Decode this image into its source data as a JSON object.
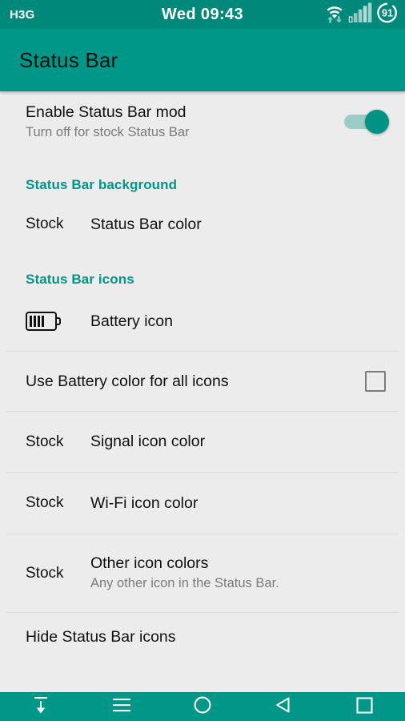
{
  "system_status_bar": {
    "carrier": "H3G",
    "clock": "Wed 09:43",
    "battery_percent": "91",
    "icons": [
      "wifi-with-data-arrows-icon",
      "cellular-signal-icon",
      "battery-circle-icon"
    ],
    "background_color": "#00897b",
    "foreground_color": "#ffffff"
  },
  "app_bar": {
    "title": "Status Bar",
    "background_color": "#009688",
    "title_color": "#111111"
  },
  "preferences": {
    "master_switch": {
      "title": "Enable Status Bar mod",
      "summary": "Turn off for stock Status Bar",
      "checked": true,
      "on_color": "#009285",
      "track_color": "#9cccc6"
    },
    "sections": [
      {
        "header": "Status Bar background",
        "header_color": "#009688",
        "items": [
          {
            "value": "Stock",
            "title": "Status Bar color",
            "summary": "",
            "widget": "none"
          }
        ]
      },
      {
        "header": "Status Bar icons",
        "header_color": "#009688",
        "items": [
          {
            "value": "",
            "title": "Battery icon",
            "summary": "",
            "widget": "battery-icon"
          },
          {
            "value": "",
            "title": "Use Battery color for all icons",
            "summary": "",
            "widget": "checkbox",
            "checked": false
          },
          {
            "value": "Stock",
            "title": "Signal icon color",
            "summary": "",
            "widget": "none"
          },
          {
            "value": "Stock",
            "title": "Wi-Fi icon color",
            "summary": "",
            "widget": "none"
          },
          {
            "value": "Stock",
            "title": "Other icon colors",
            "summary": "Any other icon in the Status Bar.",
            "widget": "none"
          },
          {
            "value": "",
            "title": "Hide Status Bar icons",
            "summary": "",
            "widget": "none"
          }
        ]
      }
    ]
  },
  "navigation_bar": {
    "background_color": "#009688",
    "buttons": [
      {
        "name": "hide-navbar-button",
        "icon": "arrow-down-with-bar-icon"
      },
      {
        "name": "menu-button",
        "icon": "hamburger-menu-icon"
      },
      {
        "name": "home-button",
        "icon": "circle-icon"
      },
      {
        "name": "back-button",
        "icon": "triangle-left-icon"
      },
      {
        "name": "recents-button",
        "icon": "square-icon"
      }
    ]
  }
}
